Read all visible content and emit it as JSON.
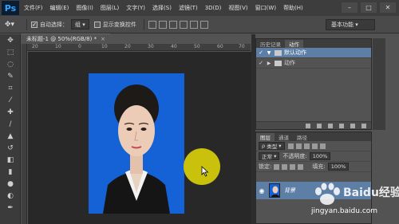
{
  "app": {
    "logo": "Ps"
  },
  "menu": {
    "items": [
      "文件(F)",
      "编辑(E)",
      "图像(I)",
      "图层(L)",
      "文字(Y)",
      "选择(S)",
      "滤镜(T)",
      "3D(D)",
      "视图(V)",
      "窗口(W)",
      "帮助(H)"
    ]
  },
  "window_controls": {
    "minimize": "–",
    "maximize": "□",
    "close": "✕"
  },
  "options": {
    "auto_select_label": "自动选择：",
    "auto_select_value": "组",
    "show_transform_label": "显示变换控件",
    "workspace": "基本功能"
  },
  "document": {
    "tab_title": "未标题-1 @ 50%(RGB/8) *",
    "close": "×"
  },
  "ruler": {
    "top_ticks": [
      "20",
      "10",
      "0",
      "10",
      "20",
      "30",
      "40",
      "50",
      "60",
      "70"
    ]
  },
  "history_panel": {
    "tabs": [
      "历史记录",
      "动作"
    ],
    "rows": [
      {
        "label": "默认动作",
        "checked": true
      },
      {
        "label": "动作",
        "checked": true
      }
    ]
  },
  "layers_panel": {
    "tabs": [
      "图层",
      "通道",
      "路径"
    ],
    "kind": "类型",
    "blend_mode": "正常",
    "opacity_label": "不透明度:",
    "opacity_value": "100%",
    "lock_label": "锁定:",
    "fill_label": "填充:",
    "fill_value": "100%",
    "layer_name": "背景"
  },
  "watermark": {
    "brand": "Baidu经验",
    "url": "jingyan.baidu.com"
  },
  "colors": {
    "photo_bg": "#1462d6",
    "cursor_highlight": "#c9c10b",
    "selected_row": "#5d7fa6"
  }
}
